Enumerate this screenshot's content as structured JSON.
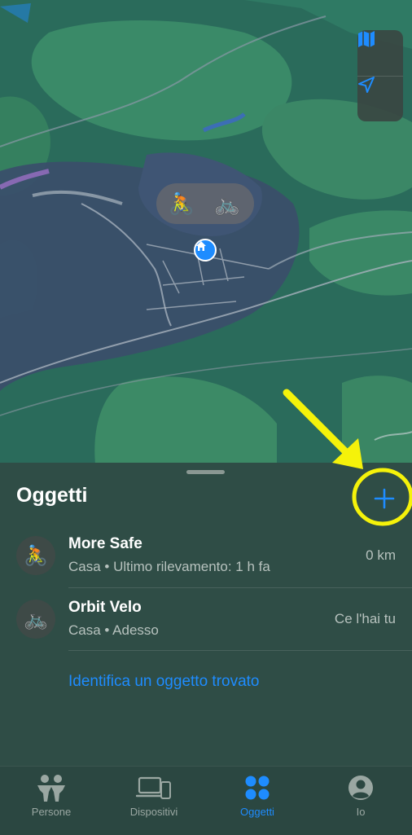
{
  "map": {
    "controls": [
      {
        "icon": "map-icon"
      },
      {
        "icon": "location-arrow-icon"
      }
    ],
    "poi_bubble": [
      {
        "icon": "cyclist-emoji-icon",
        "glyph": "🚴"
      },
      {
        "icon": "bicycle-emoji-icon",
        "glyph": "🚲"
      }
    ],
    "home_pin": {
      "icon": "home-icon"
    }
  },
  "sheet": {
    "title": "Oggetti",
    "add_button": {
      "icon": "plus-icon"
    },
    "items": [
      {
        "name": "More Safe",
        "subtitle": "Casa • Ultimo rilevamento: 1 h fa",
        "right": "0 km",
        "avatar_glyph": "🚴",
        "avatar_icon": "cyclist-emoji-icon"
      },
      {
        "name": "Orbit Velo",
        "subtitle": "Casa • Adesso",
        "right": "Ce l'hai tu",
        "avatar_glyph": "🚲",
        "avatar_icon": "bicycle-emoji-icon"
      }
    ],
    "identify_link": "Identifica un oggetto trovato"
  },
  "tabbar": {
    "tabs": [
      {
        "label": "Persone",
        "icon": "people-icon",
        "active": false
      },
      {
        "label": "Dispositivi",
        "icon": "devices-icon",
        "active": false
      },
      {
        "label": "Oggetti",
        "icon": "items-grid-icon",
        "active": true
      },
      {
        "label": "Io",
        "icon": "person-circle-icon",
        "active": false
      }
    ]
  },
  "colors": {
    "accent": "#1e8cff",
    "annotation": "#f5f20a",
    "sheet_bg": "#2f4d46"
  }
}
